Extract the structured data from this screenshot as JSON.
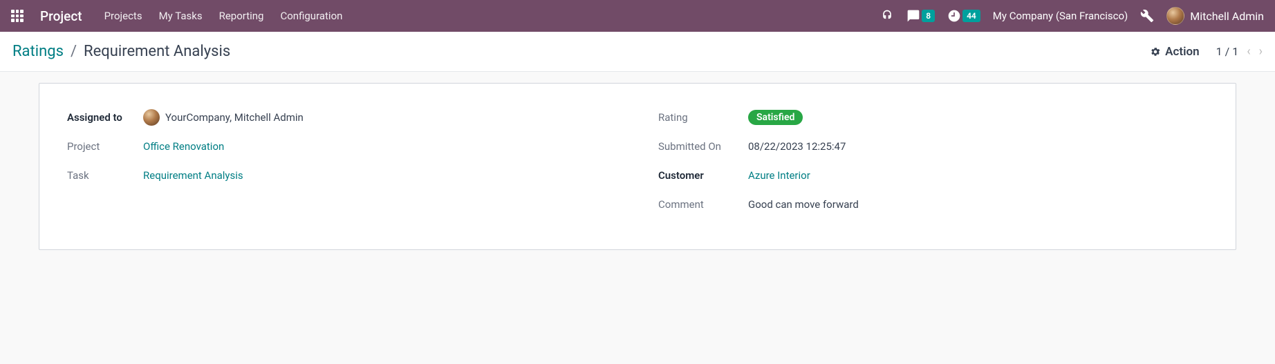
{
  "navbar": {
    "brand": "Project",
    "links": [
      "Projects",
      "My Tasks",
      "Reporting",
      "Configuration"
    ],
    "messages_badge": "8",
    "activities_badge": "44",
    "company": "My Company (San Francisco)",
    "user_name": "Mitchell Admin"
  },
  "breadcrumb": {
    "parent": "Ratings",
    "current": "Requirement Analysis"
  },
  "action_label": "Action",
  "pager": {
    "current": "1",
    "total": "1"
  },
  "form": {
    "assigned_to_label": "Assigned to",
    "assigned_to_value": "YourCompany, Mitchell Admin",
    "project_label": "Project",
    "project_value": "Office Renovation",
    "task_label": "Task",
    "task_value": "Requirement Analysis",
    "rating_label": "Rating",
    "rating_value": "Satisfied",
    "submitted_label": "Submitted On",
    "submitted_value": "08/22/2023 12:25:47",
    "customer_label": "Customer",
    "customer_value": "Azure Interior",
    "comment_label": "Comment",
    "comment_value": "Good can move forward"
  }
}
